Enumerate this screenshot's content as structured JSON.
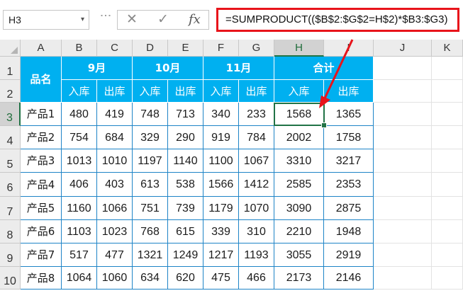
{
  "namebox": {
    "value": "H3",
    "chevron": "▾"
  },
  "formula_bar": {
    "separator": "⋮",
    "cancel_icon": "✕",
    "enter_icon": "✓",
    "fx_label": "fx",
    "formula": "=SUMPRODUCT(($B$2:$G$2=H$2)*$B3:$G3)"
  },
  "columns": [
    "A",
    "B",
    "C",
    "D",
    "E",
    "F",
    "G",
    "H",
    "I",
    "J",
    "K"
  ],
  "rows": [
    "1",
    "2",
    "3",
    "4",
    "5",
    "6",
    "7",
    "8",
    "9",
    "10"
  ],
  "selected": {
    "column": "H",
    "row": "3"
  },
  "table": {
    "name_header": "品名",
    "months": [
      "9月",
      "10月",
      "11月",
      "合计"
    ],
    "sub_headers": [
      "入库",
      "出库",
      "入库",
      "出库",
      "入库",
      "出库",
      "入库",
      "出库"
    ],
    "records": [
      {
        "name": "产品1",
        "values": [
          "480",
          "419",
          "748",
          "713",
          "340",
          "233",
          "1568",
          "1365"
        ]
      },
      {
        "name": "产品2",
        "values": [
          "754",
          "684",
          "329",
          "290",
          "919",
          "784",
          "2002",
          "1758"
        ]
      },
      {
        "name": "产品3",
        "values": [
          "1013",
          "1010",
          "1197",
          "1140",
          "1100",
          "1067",
          "3310",
          "3217"
        ]
      },
      {
        "name": "产品4",
        "values": [
          "406",
          "403",
          "613",
          "538",
          "1566",
          "1412",
          "2585",
          "2353"
        ]
      },
      {
        "name": "产品5",
        "values": [
          "1160",
          "1066",
          "751",
          "739",
          "1179",
          "1070",
          "3090",
          "2875"
        ]
      },
      {
        "name": "产品6",
        "values": [
          "1103",
          "1023",
          "768",
          "615",
          "339",
          "310",
          "2210",
          "1948"
        ]
      },
      {
        "name": "产品7",
        "values": [
          "517",
          "477",
          "1321",
          "1249",
          "1217",
          "1193",
          "3055",
          "2919"
        ]
      },
      {
        "name": "产品8",
        "values": [
          "1064",
          "1060",
          "634",
          "620",
          "475",
          "466",
          "2173",
          "2146"
        ]
      }
    ]
  },
  "colors": {
    "header_fill": "#00b0f0",
    "grid_line": "#1e84c7",
    "highlight_red": "#e8141b",
    "selection_green": "#217346"
  }
}
